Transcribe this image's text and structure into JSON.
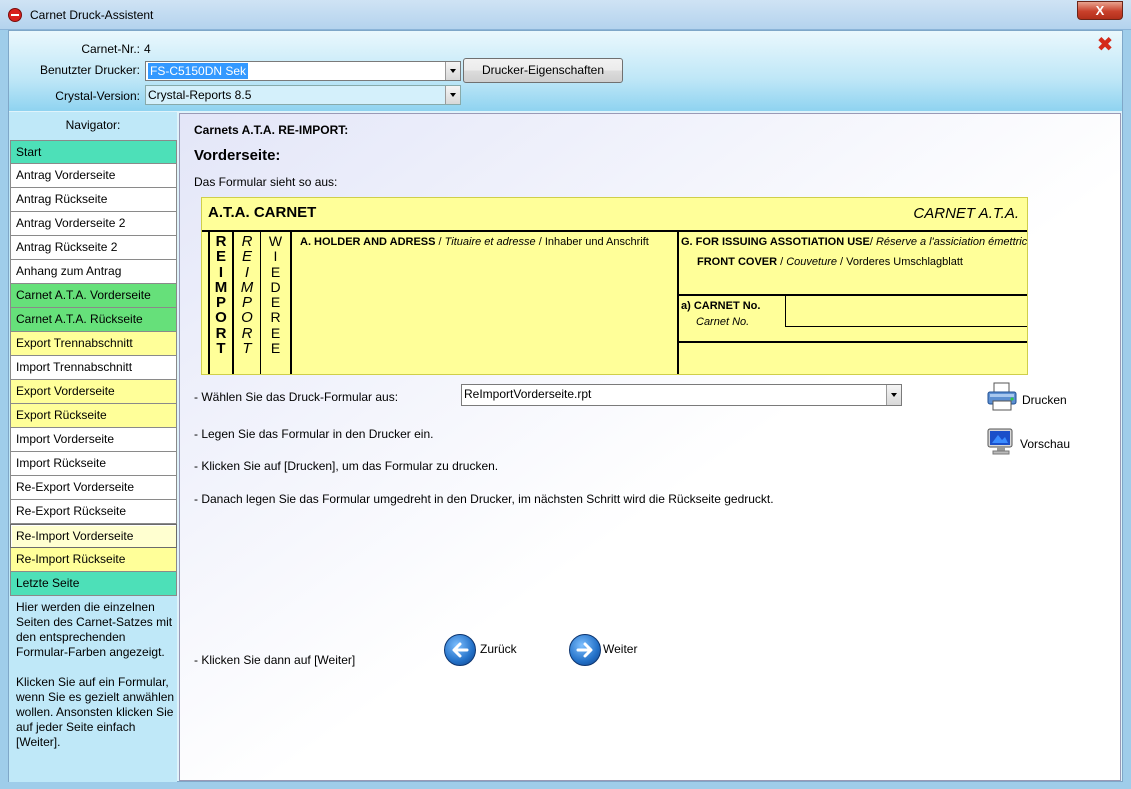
{
  "window": {
    "title": "Carnet Druck-Assistent",
    "close_symbol": "X"
  },
  "header": {
    "carnet_nr_label": "Carnet-Nr.:",
    "carnet_nr_value": "4",
    "printer_label": "Benutzter Drucker:",
    "printer_value": "FS-C5150DN Sek",
    "printer_props_button": "Drucker-Eigenschaften",
    "crystal_label": "Crystal-Version:",
    "crystal_value": "Crystal-Reports 8.5",
    "close_icon": "✖"
  },
  "navigator": {
    "title": "Navigator:",
    "items": [
      {
        "label": "Start",
        "color": "turq"
      },
      {
        "label": "Antrag Vorderseite",
        "color": "white"
      },
      {
        "label": "Antrag Rückseite",
        "color": "white"
      },
      {
        "label": "Antrag Vorderseite 2",
        "color": "white"
      },
      {
        "label": "Antrag Rückseite 2",
        "color": "white"
      },
      {
        "label": "Anhang zum Antrag",
        "color": "white"
      },
      {
        "label": "Carnet A.T.A. Vorderseite",
        "color": "green"
      },
      {
        "label": "Carnet A.T.A. Rückseite",
        "color": "green"
      },
      {
        "label": "Export Trennabschnitt",
        "color": "yellow"
      },
      {
        "label": "Import Trennabschnitt",
        "color": "white"
      },
      {
        "label": "Export Vorderseite",
        "color": "yellow"
      },
      {
        "label": "Export Rückseite",
        "color": "yellow"
      },
      {
        "label": "Import Vorderseite",
        "color": "white"
      },
      {
        "label": "Import Rückseite",
        "color": "white"
      },
      {
        "label": "Re-Export Vorderseite",
        "color": "white"
      },
      {
        "label": "Re-Export Rückseite",
        "color": "white"
      },
      {
        "label": "Re-Import Vorderseite",
        "color": "active"
      },
      {
        "label": "Re-Import Rückseite",
        "color": "yellow"
      },
      {
        "label": "Letzte Seite",
        "color": "turq"
      }
    ],
    "help_text": "Hier werden die einzelnen Seiten des Carnet-Satzes mit den entsprechenden Formular-Farben angezeigt.\n\nKlicken Sie auf ein Formular, wenn Sie es gezielt anwählen wollen. Ansonsten klicken Sie auf jeder Seite einfach [Weiter]."
  },
  "main": {
    "heading": "Carnets A.T.A. RE-IMPORT:",
    "subheading": "Vorderseite:",
    "description": "Das Formular sieht so aus:",
    "preview": {
      "title": "A.T.A. CARNET",
      "title_right": "CARNET A.T.A.",
      "col1": [
        "R",
        "E",
        "I",
        "M",
        "P",
        "O",
        "R",
        "T"
      ],
      "col2": [
        "R",
        "E",
        "I",
        "M",
        "P",
        "O",
        "R",
        "T"
      ],
      "col3": [
        "W",
        "I",
        "E",
        "D",
        "E",
        "R",
        "E",
        "E"
      ],
      "holder_bold": "A. HOLDER AND ADRESS",
      "holder_sep1": " / ",
      "holder_italic": "Tituaire et adresse",
      "holder_sep2": " / ",
      "holder_plain": "Inhaber und Anschrift",
      "issuing_bold": "G. FOR ISSUING ASSOTIATION USE",
      "issuing_sep": "/ ",
      "issuing_italic": "Réserve a l'assiciation émettrice",
      "front_bold": "FRONT COVER",
      "front_sep1": " / ",
      "front_italic": "Couveture",
      "front_sep2": " / ",
      "front_plain": "Vorderes Umschlagblatt",
      "carnet_no_bold": "a) CARNET No.",
      "carnet_no_italic": "Carnet No."
    },
    "choose_label": "- Wählen Sie das Druck-Formular aus:",
    "form_value": "ReImportVorderseite.rpt",
    "step1": "- Legen Sie das Formular in den Drucker ein.",
    "step2": "- Klicken Sie auf [Drucken], um das Formular zu drucken.",
    "step3": "- Danach legen Sie das Formular umgedreht in den Drucker, im nächsten Schritt wird die Rückseite gedruckt.",
    "step4": "- Klicken Sie dann auf [Weiter]",
    "print_label": "Drucken",
    "preview_label": "Vorschau",
    "back_label": "Zurück",
    "next_label": "Weiter"
  }
}
